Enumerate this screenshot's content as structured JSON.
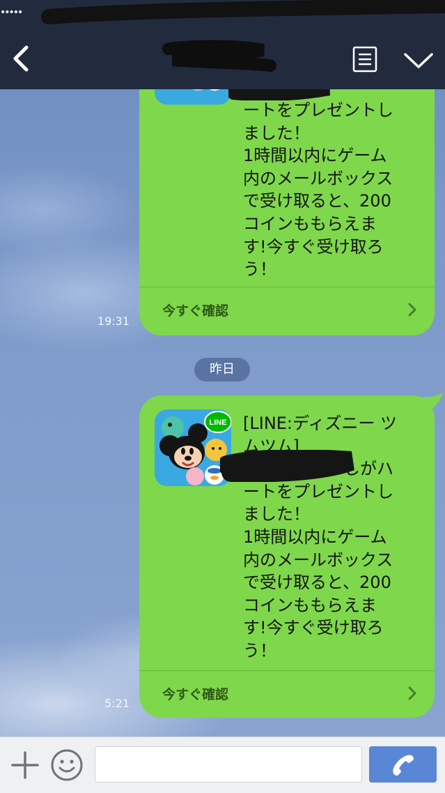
{
  "header": {
    "status_dots": "•••••",
    "back_icon": "chevron-left-icon",
    "menu_icon": "list-icon",
    "collapse_icon": "chevron-down-icon"
  },
  "messages": [
    {
      "text": "ートをプレゼントし\nました！\n1時間以内にゲーム\n内のメールボックス\nで受け取ると、200\nコインももらえま\nす!今すぐ受け取ろ\nう！",
      "action_label": "今すぐ確認",
      "time": "19:31"
    },
    {
      "text": "[LINE:ディズニー ツ\nムツム]\n　　　　　　しがハ\nートをプレゼントし\nました！\n1時間以内にゲーム\n内のメールボックス\nで受け取ると、200\nコインももらえま\nす!今すぐ受け取ろ\nう！",
      "action_label": "今すぐ確認",
      "time": "5:21"
    }
  ],
  "date_separator": "昨日",
  "app_icon_badge": "LINE",
  "input_bar": {
    "message_value": "",
    "plus_icon": "plus-icon",
    "emoji_icon": "smiley-icon",
    "call_icon": "phone-icon"
  },
  "colors": {
    "header": "#222b3e",
    "bubble": "#7fd74c",
    "call_button": "#5a86d6"
  }
}
